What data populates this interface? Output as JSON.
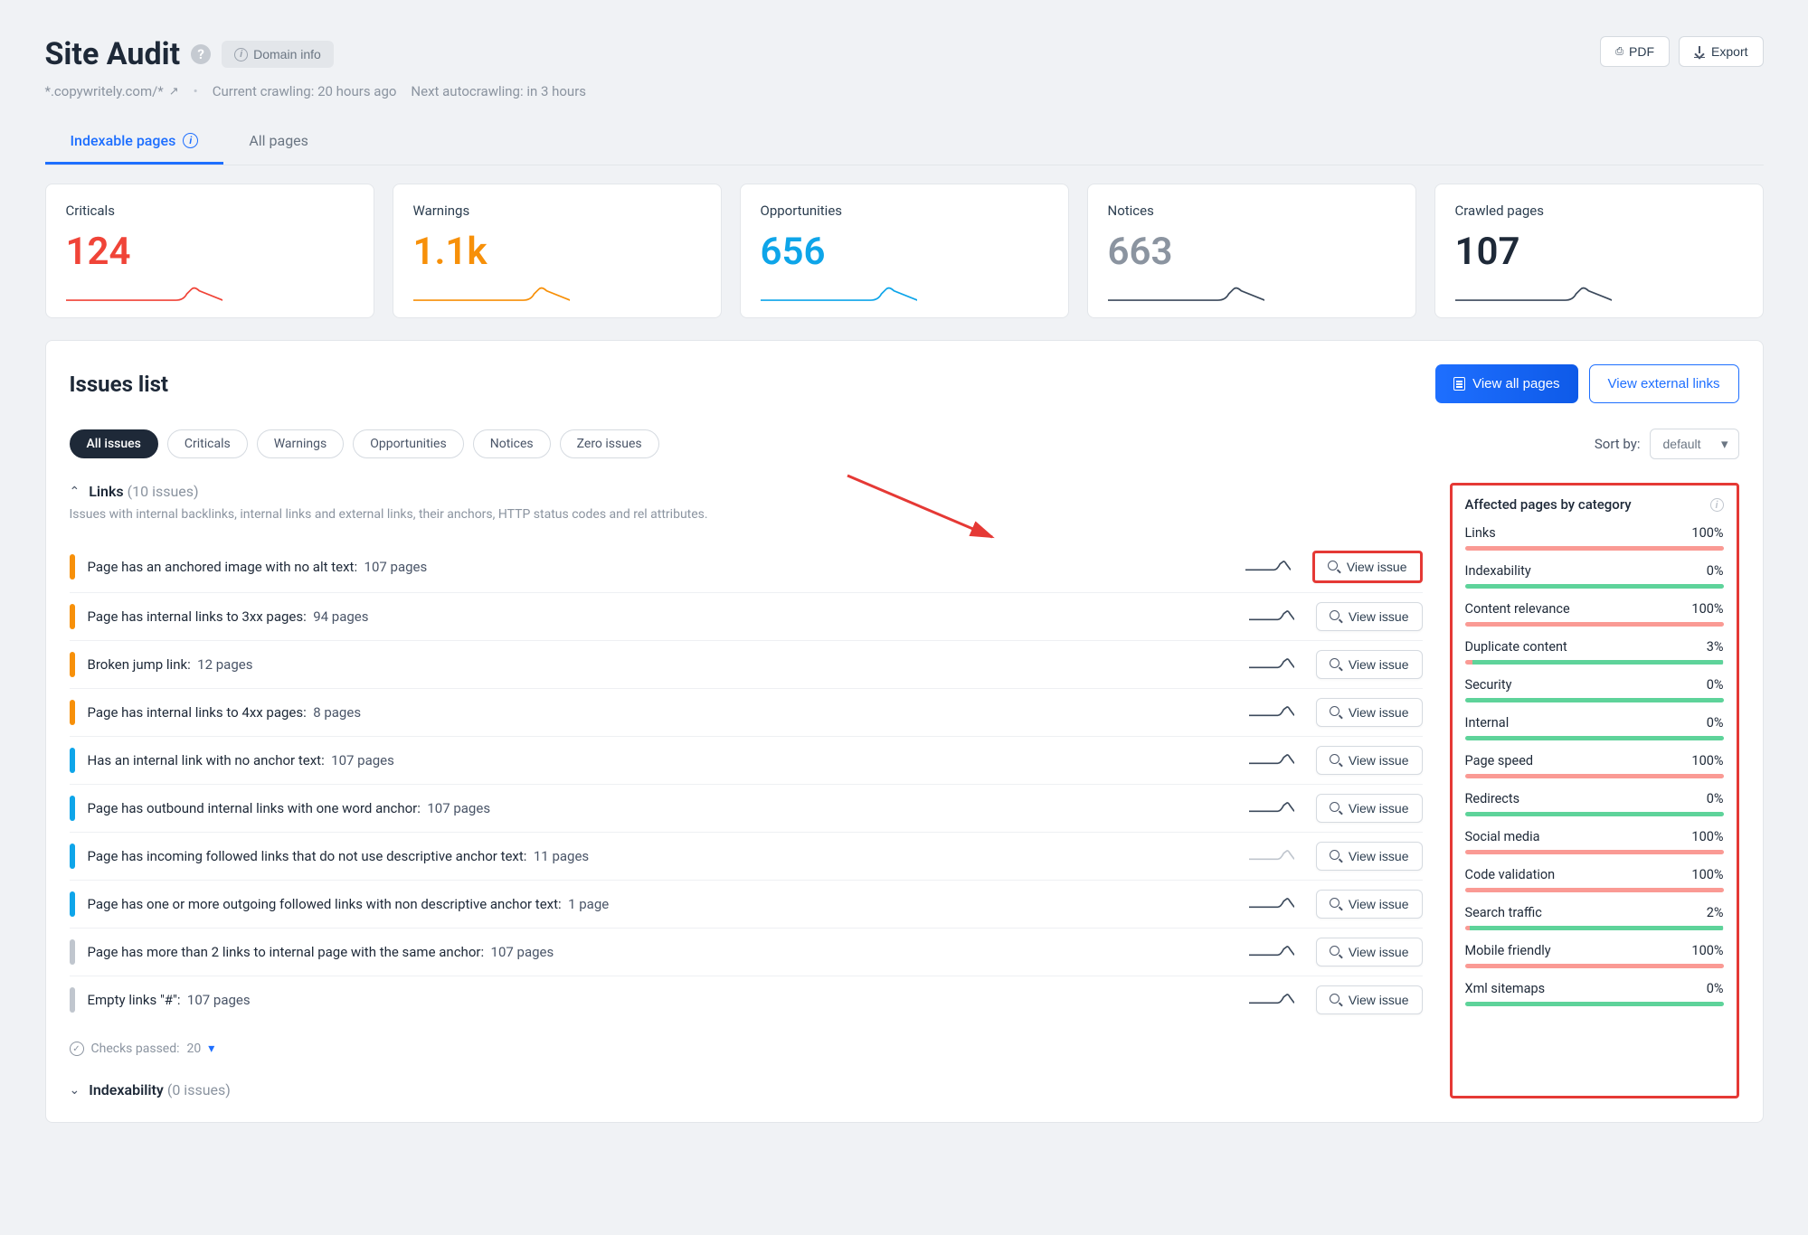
{
  "header": {
    "title": "Site Audit",
    "domain_info_btn": "Domain info",
    "pdf_btn": "PDF",
    "export_btn": "Export"
  },
  "subheader": {
    "domain": "*.copywritely.com/*",
    "crawling": "Current crawling: 20 hours ago",
    "next": "Next autocrawling: in 3 hours"
  },
  "tabs": {
    "indexable": "Indexable pages",
    "all": "All pages"
  },
  "stats": [
    {
      "label": "Criticals",
      "value": "124",
      "color": "red",
      "spark": "#f04438"
    },
    {
      "label": "Warnings",
      "value": "1.1k",
      "color": "orange",
      "spark": "#f79009"
    },
    {
      "label": "Opportunities",
      "value": "656",
      "color": "blue",
      "spark": "#0ea5e9"
    },
    {
      "label": "Notices",
      "value": "663",
      "color": "gray",
      "spark": "#3c4a5c"
    },
    {
      "label": "Crawled pages",
      "value": "107",
      "color": "dark",
      "spark": "#3c4a5c"
    }
  ],
  "issues": {
    "title": "Issues list",
    "view_all_pages": "View all pages",
    "view_external": "View external links",
    "filters": [
      "All issues",
      "Criticals",
      "Warnings",
      "Opportunities",
      "Notices",
      "Zero issues"
    ],
    "sort_label": "Sort by:",
    "sort_value": "default"
  },
  "links_section": {
    "title": "Links",
    "count": "(10 issues)",
    "desc": "Issues with internal backlinks, internal links and external links, their anchors, HTTP status codes and rel attributes.",
    "items": [
      {
        "severity": "orange",
        "text": "Page has an anchored image with no alt text:",
        "pages": "107 pages",
        "highlight": true
      },
      {
        "severity": "orange",
        "text": "Page has internal links to 3xx pages:",
        "pages": "94 pages"
      },
      {
        "severity": "orange",
        "text": "Broken jump link:",
        "pages": "12 pages"
      },
      {
        "severity": "orange",
        "text": "Page has internal links to 4xx pages:",
        "pages": "8 pages"
      },
      {
        "severity": "blue",
        "text": "Has an internal link with no anchor text:",
        "pages": "107 pages"
      },
      {
        "severity": "blue",
        "text": "Page has outbound internal links with one word anchor:",
        "pages": "107 pages"
      },
      {
        "severity": "blue",
        "text": "Page has incoming followed links that do not use descriptive anchor text:",
        "pages": "11 pages",
        "graySpark": true
      },
      {
        "severity": "blue",
        "text": "Page has one or more outgoing followed links with non descriptive anchor text:",
        "pages": "1 page"
      },
      {
        "severity": "gray",
        "text": "Page has more than 2 links to internal page with the same anchor:",
        "pages": "107 pages"
      },
      {
        "severity": "gray",
        "text": "Empty links \"#\":",
        "pages": "107 pages"
      }
    ],
    "view_issue": "View issue",
    "checks_passed_label": "Checks passed:",
    "checks_passed_value": "20"
  },
  "indexability_section": {
    "title": "Indexability",
    "count": "(0 issues)"
  },
  "categories": {
    "title": "Affected pages by category",
    "items": [
      {
        "name": "Links",
        "pct": "100%",
        "color": "red",
        "fill": 100
      },
      {
        "name": "Indexability",
        "pct": "0%",
        "color": "green",
        "fill": 100
      },
      {
        "name": "Content relevance",
        "pct": "100%",
        "color": "red",
        "fill": 100
      },
      {
        "name": "Duplicate content",
        "pct": "3%",
        "color": "mix",
        "fill": 3
      },
      {
        "name": "Security",
        "pct": "0%",
        "color": "green",
        "fill": 100
      },
      {
        "name": "Internal",
        "pct": "0%",
        "color": "green",
        "fill": 100
      },
      {
        "name": "Page speed",
        "pct": "100%",
        "color": "red",
        "fill": 100
      },
      {
        "name": "Redirects",
        "pct": "0%",
        "color": "green",
        "fill": 100
      },
      {
        "name": "Social media",
        "pct": "100%",
        "color": "red",
        "fill": 100
      },
      {
        "name": "Code validation",
        "pct": "100%",
        "color": "red",
        "fill": 100
      },
      {
        "name": "Search traffic",
        "pct": "2%",
        "color": "mix",
        "fill": 2
      },
      {
        "name": "Mobile friendly",
        "pct": "100%",
        "color": "red",
        "fill": 100
      },
      {
        "name": "Xml sitemaps",
        "pct": "0%",
        "color": "green",
        "fill": 100
      }
    ]
  }
}
